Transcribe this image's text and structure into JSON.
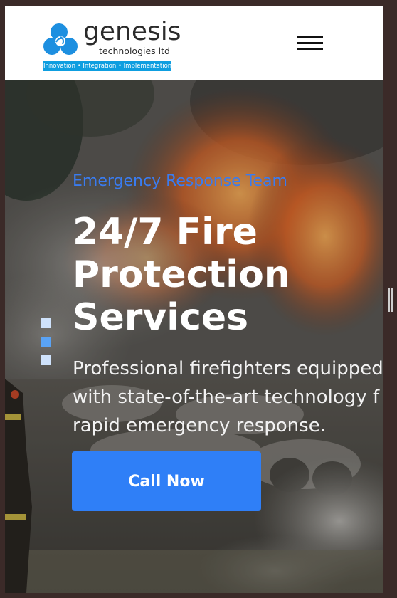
{
  "header": {
    "logo": {
      "name": "genesis",
      "subtitle": "technologies ltd",
      "tagline": "Innovation • Integration • Implementation",
      "brand_color": "#0e9ee0"
    },
    "menu_icon": "hamburger-menu-icon"
  },
  "hero": {
    "kicker": "Emergency Response Team",
    "title": "24/7 Fire\nProtection\nServices",
    "description_lines": [
      "Professional firefighters equipped",
      "with state-of-the-art technology f",
      "rapid emergency response."
    ],
    "cta_label": "Call Now",
    "slides": 3,
    "active_slide": 1,
    "colors": {
      "accent": "#2f7ff7",
      "kicker": "#3a7cf0",
      "dot_active": "#5aa3f5",
      "dot_inactive": "#cfe2fb"
    }
  }
}
